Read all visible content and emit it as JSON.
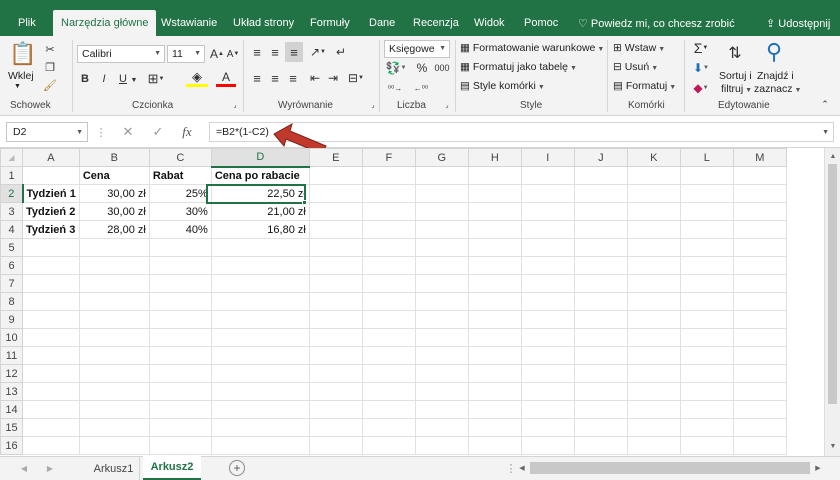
{
  "tabs": [
    "Plik",
    "Narzędzia główne",
    "Wstawianie",
    "Układ strony",
    "Formuły",
    "Dane",
    "Recenzja",
    "Widok",
    "Pomoc"
  ],
  "tell_me": "Powiedz mi, co chcesz zrobić",
  "share": "Udostępnij",
  "clipboard": {
    "paste": "Wklej",
    "group": "Schowek"
  },
  "font": {
    "name": "Calibri",
    "size": "11",
    "bold": "B",
    "italic": "I",
    "underline": "U",
    "group": "Czcionka"
  },
  "alignment": {
    "group": "Wyrównanie"
  },
  "number": {
    "format": "Księgowe",
    "percent": "%",
    "thousands": "000",
    "group": "Liczba"
  },
  "styles": {
    "cond": "Formatowanie warunkowe",
    "table": "Formatuj jako tabelę",
    "cell": "Style komórki",
    "group": "Style"
  },
  "cells": {
    "insert": "Wstaw",
    "delete": "Usuń",
    "format": "Formatuj",
    "group": "Komórki"
  },
  "editing": {
    "sort1": "Sortuj i",
    "sort2": "filtruj",
    "find1": "Znajdź i",
    "find2": "zaznacz",
    "group": "Edytowanie"
  },
  "namebox": "D2",
  "formula": "=B2*(1-C2)",
  "columns": [
    "A",
    "B",
    "C",
    "D",
    "E",
    "F",
    "G",
    "H",
    "I",
    "J",
    "K",
    "L",
    "M"
  ],
  "rows": [
    "1",
    "2",
    "3",
    "4",
    "5",
    "6",
    "7",
    "8",
    "9",
    "10",
    "11",
    "12",
    "13",
    "14",
    "15",
    "16"
  ],
  "cells_data": {
    "B1": "Cena",
    "C1": "Rabat",
    "D1": "Cena po rabacie",
    "A2": "Tydzień 1",
    "B2": "30,00 zł",
    "C2": "25%",
    "D2": "22,50 zł",
    "A3": "Tydzień 2",
    "B3": "30,00 zł",
    "C3": "30%",
    "D3": "21,00 zł",
    "A4": "Tydzień 3",
    "B4": "28,00 zł",
    "C4": "40%",
    "D4": "16,80 zł"
  },
  "sheets": [
    "Arkusz1",
    "Arkusz2"
  ],
  "active_sheet": "Arkusz2",
  "colors": {
    "brand": "#217346",
    "arrow": "#c0392b"
  }
}
